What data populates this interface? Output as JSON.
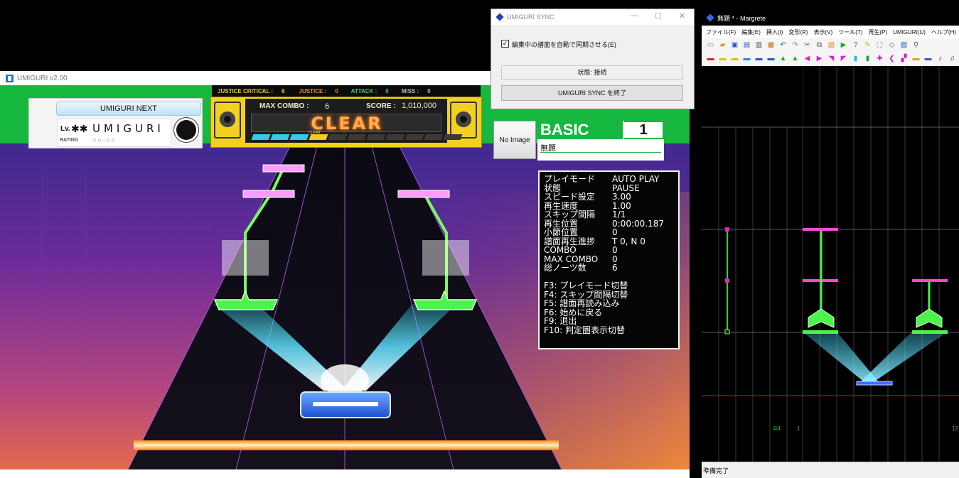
{
  "umiguri": {
    "window_title": "UMIGURI v2.00",
    "player": {
      "next_label": "UMIGURI NEXT",
      "level_label": "Lv.",
      "level_value": "✱✱",
      "name": "UMIGURI",
      "rating_label": "RATING",
      "rating_value": "○○.○○"
    },
    "judgements": [
      {
        "label": "JUSTICE CRITICAL :",
        "value": "6"
      },
      {
        "label": "JUSTICE :",
        "value": "0"
      },
      {
        "label": "ATTACK :",
        "value": "0"
      },
      {
        "label": "MISS :",
        "value": "0"
      }
    ],
    "max_combo_label": "MAX COMBO :",
    "max_combo_value": "6",
    "score_label": "SCORE :",
    "score_value": "1,010,000",
    "clear_text": "CLEAR",
    "clear_mini_text": "CLEAR",
    "gauge": {
      "filled": 4,
      "total": 11
    },
    "jacket_text": "No Image",
    "difficulty_name": "BASIC",
    "difficulty_level": "1",
    "song_title": "無題",
    "info": [
      {
        "key": "プレイモード",
        "value": "AUTO PLAY"
      },
      {
        "key": "状態",
        "value": "PAUSE"
      },
      {
        "key": "スピード設定",
        "value": "3.00"
      },
      {
        "key": "再生速度",
        "value": "1.00"
      },
      {
        "key": "スキップ間隔",
        "value": "1/1"
      },
      {
        "key": "再生位置",
        "value": "0:00:00.187"
      },
      {
        "key": "小節位置",
        "value": "0"
      },
      {
        "key": "譜面再生進捗",
        "value": "T 0, N 0"
      },
      {
        "key": "COMBO",
        "value": "0"
      },
      {
        "key": "MAX COMBO",
        "value": "0"
      },
      {
        "key": "総ノーツ数",
        "value": "6"
      }
    ],
    "shortcuts": [
      "F3: プレイモード切替",
      "F4: スキップ間隔切替",
      "F5: 譜面再読み込み",
      "F6: 始めに戻る",
      "F9: 退出",
      "F10: 判定圏表示切替"
    ],
    "colors": {
      "hud_green": "#16b83f",
      "score_yellow": "#f3d21f",
      "clear_orange": "#ffad56",
      "gauge_cyan": "#39c6e8",
      "gauge_yellow": "#f2c91c"
    }
  },
  "sync": {
    "title": "UMIGURI SYNC",
    "checkbox_label": "編集中の譜面を自動で同期させる(E)",
    "checkbox_checked": "✓",
    "status_text": "状態: 接続",
    "end_button": "UMIGURI SYNC を終了",
    "minimize": "—",
    "maximize": "☐",
    "close": "✕"
  },
  "margrete": {
    "title": "無題 * - Margrete",
    "menu": [
      "ファイル(F)",
      "編集(E)",
      "挿入(I)",
      "変形(R)",
      "表示(V)",
      "ツール(T)",
      "再生(P)",
      "UMIGURI(U)",
      "ヘルプ(H)"
    ],
    "toolbar1_icons": [
      "new-file-icon",
      "open-folder-icon",
      "save-icon",
      "copy-doc-icon",
      "print-icon",
      "export-icon",
      "undo-icon",
      "redo-icon",
      "cut-icon",
      "copy-icon",
      "paste-icon",
      "play-icon",
      "help-icon",
      "pen-icon",
      "select-icon",
      "eraser-icon",
      "fill-icon",
      "zoom-icon"
    ],
    "toolbar2_icons": [
      "tap-note-icon",
      "ex-note-icon",
      "flick-note-icon",
      "damage-note-icon",
      "hold-note-icon",
      "slide-note-icon",
      "air-up-icon",
      "air-down-icon",
      "air-left-icon",
      "air-right-icon",
      "air-ul-icon",
      "air-ur-icon",
      "air-hold-icon",
      "air-action-icon",
      "crash-icon",
      "bpm-icon",
      "speed-icon",
      "left-icon",
      "right-icon",
      "timesig-icon",
      "note-icon"
    ],
    "time_signature": "4/4",
    "measure_1": "1",
    "measure_next": "12",
    "status": "準備完了"
  }
}
